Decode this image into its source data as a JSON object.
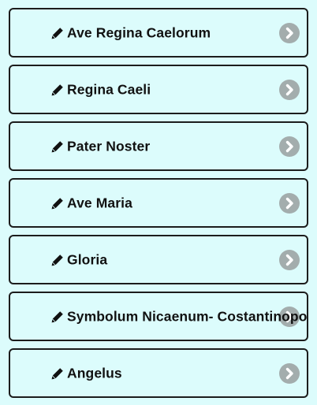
{
  "prayers": [
    {
      "label": "Ave Regina Caelorum",
      "edit_icon": "pencil-icon",
      "nav_icon": "chevron-right-icon"
    },
    {
      "label": "Regina Caeli",
      "edit_icon": "pencil-icon",
      "nav_icon": "chevron-right-icon"
    },
    {
      "label": "Pater Noster",
      "edit_icon": "pencil-icon",
      "nav_icon": "chevron-right-icon"
    },
    {
      "label": "Ave Maria",
      "edit_icon": "pencil-icon",
      "nav_icon": "chevron-right-icon"
    },
    {
      "label": "Gloria",
      "edit_icon": "pencil-icon",
      "nav_icon": "chevron-right-icon"
    },
    {
      "label": "Symbolum Nicaenum- Costantinopolit",
      "edit_icon": "pencil-icon",
      "nav_icon": "chevron-right-icon"
    },
    {
      "label": "Angelus",
      "edit_icon": "pencil-icon",
      "nav_icon": "chevron-right-icon"
    }
  ],
  "colors": {
    "background": "#dcfcfc",
    "border": "#1c1c1c",
    "text": "#111111",
    "chevron_circle": "#a3adad",
    "chevron_arrow": "#ffffff"
  }
}
